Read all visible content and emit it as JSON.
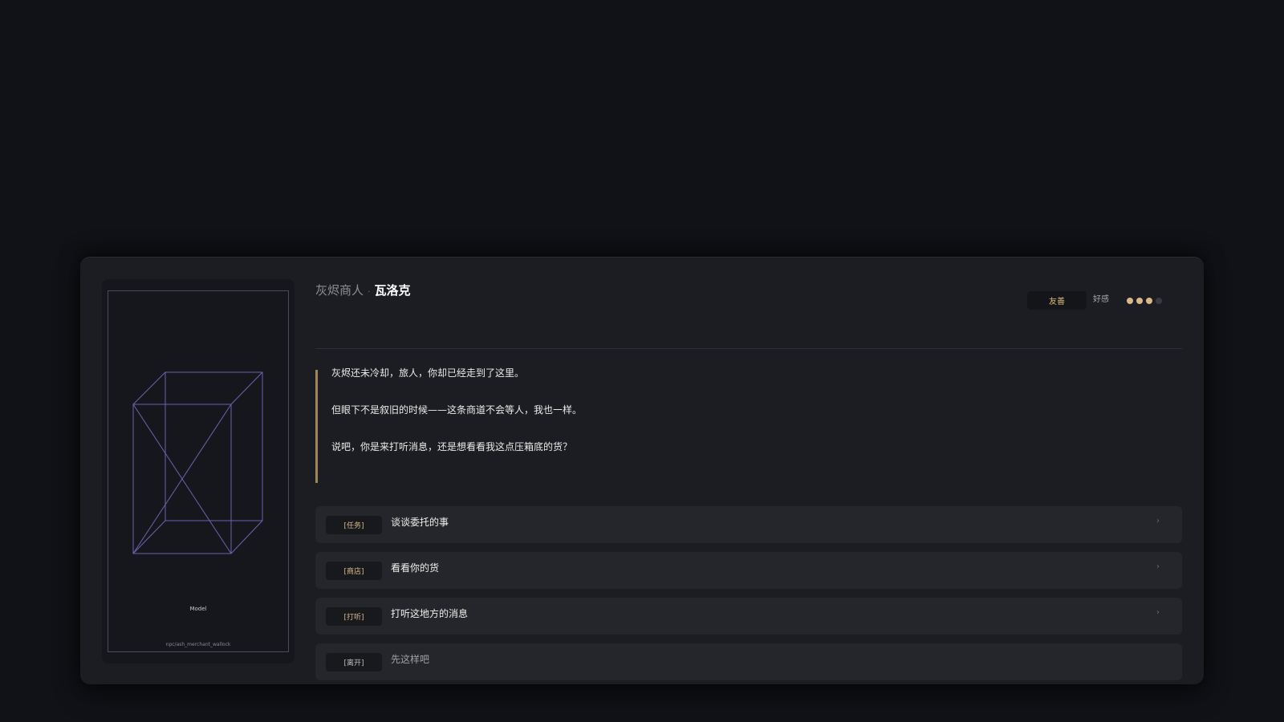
{
  "npc": {
    "faction": "灰烬商人",
    "separator": "·",
    "name": "瓦洛克",
    "relation": "友善",
    "affinity_label": "好感",
    "affinity_level": 3,
    "affinity_max": 4,
    "model_label": "Model",
    "model_path": "npc/ash_merchant_wallock"
  },
  "dialogue": {
    "lines": [
      "灰烬还未冷却，旅人，你却已经走到了这里。",
      "但眼下不是叙旧的时候——这条商道不会等人，我也一样。",
      "说吧，你是来打听消息，还是想看看我这点压箱底的货？"
    ]
  },
  "options": [
    {
      "tag": "[任务]",
      "label": "谈谈委托的事",
      "chevron": "›"
    },
    {
      "tag": "[商店]",
      "label": "看看你的货",
      "chevron": "›"
    },
    {
      "tag": "[打听]",
      "label": "打听这地方的消息",
      "chevron": "›"
    },
    {
      "tag": "[离开]",
      "label": "先这样吧"
    }
  ],
  "colors": {
    "accent_gold": "#d9b88a",
    "quote_bar": "#a08558",
    "wireframe": "#6b62b0",
    "panel_bg": "#1c1d22"
  }
}
